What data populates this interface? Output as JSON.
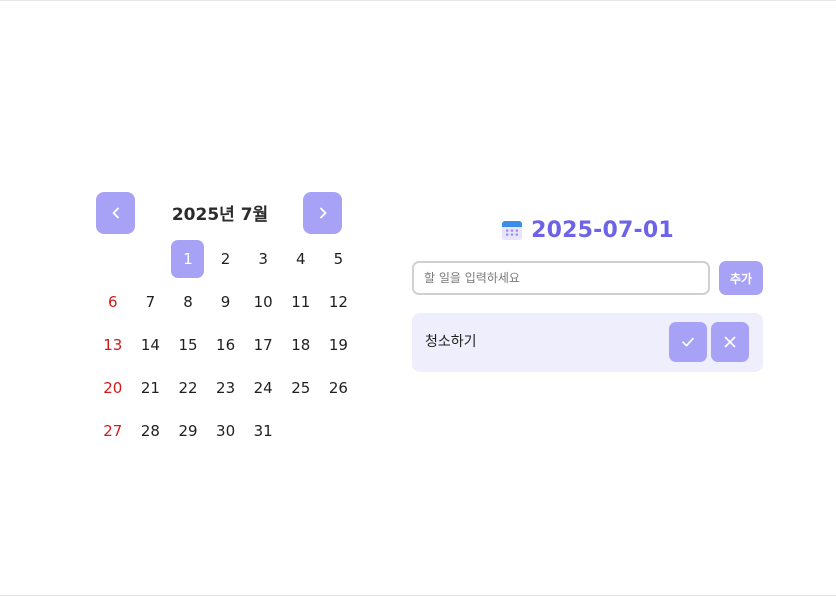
{
  "calendar": {
    "title": "2025년 7월",
    "prev_icon": "chevron-left-icon",
    "next_icon": "chevron-right-icon",
    "leading_blanks": 2,
    "selected_day": 1,
    "days": [
      {
        "label": "1",
        "sunday": false,
        "selected": true
      },
      {
        "label": "2",
        "sunday": false,
        "selected": false
      },
      {
        "label": "3",
        "sunday": false,
        "selected": false
      },
      {
        "label": "4",
        "sunday": false,
        "selected": false
      },
      {
        "label": "5",
        "sunday": false,
        "selected": false
      },
      {
        "label": "6",
        "sunday": true,
        "selected": false
      },
      {
        "label": "7",
        "sunday": false,
        "selected": false
      },
      {
        "label": "8",
        "sunday": false,
        "selected": false
      },
      {
        "label": "9",
        "sunday": false,
        "selected": false
      },
      {
        "label": "10",
        "sunday": false,
        "selected": false
      },
      {
        "label": "11",
        "sunday": false,
        "selected": false
      },
      {
        "label": "12",
        "sunday": false,
        "selected": false
      },
      {
        "label": "13",
        "sunday": true,
        "selected": false
      },
      {
        "label": "14",
        "sunday": false,
        "selected": false
      },
      {
        "label": "15",
        "sunday": false,
        "selected": false
      },
      {
        "label": "16",
        "sunday": false,
        "selected": false
      },
      {
        "label": "17",
        "sunday": false,
        "selected": false
      },
      {
        "label": "18",
        "sunday": false,
        "selected": false
      },
      {
        "label": "19",
        "sunday": false,
        "selected": false
      },
      {
        "label": "20",
        "sunday": true,
        "selected": false
      },
      {
        "label": "21",
        "sunday": false,
        "selected": false
      },
      {
        "label": "22",
        "sunday": false,
        "selected": false
      },
      {
        "label": "23",
        "sunday": false,
        "selected": false
      },
      {
        "label": "24",
        "sunday": false,
        "selected": false
      },
      {
        "label": "25",
        "sunday": false,
        "selected": false
      },
      {
        "label": "26",
        "sunday": false,
        "selected": false
      },
      {
        "label": "27",
        "sunday": true,
        "selected": false
      },
      {
        "label": "28",
        "sunday": false,
        "selected": false
      },
      {
        "label": "29",
        "sunday": false,
        "selected": false
      },
      {
        "label": "30",
        "sunday": false,
        "selected": false
      },
      {
        "label": "31",
        "sunday": false,
        "selected": false
      }
    ]
  },
  "todo": {
    "date_icon": "calendar-icon",
    "date": "2025-07-01",
    "input_placeholder": "할 일을 입력하세요",
    "input_value": "",
    "add_label": "추가",
    "items": [
      {
        "text": "청소하기",
        "complete_icon": "check-icon",
        "delete_icon": "close-icon"
      }
    ]
  },
  "colors": {
    "accent": "#a8a2f7",
    "date_text": "#6e63e8",
    "sunday": "#d11a1a",
    "item_bg": "#efeefc"
  }
}
